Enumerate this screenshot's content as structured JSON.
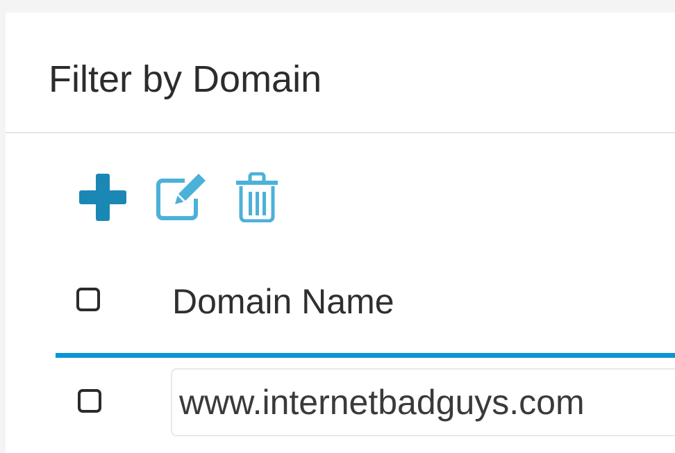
{
  "panel": {
    "title": "Filter by Domain"
  },
  "toolbar": {
    "add_icon": "plus-icon",
    "edit_icon": "edit-icon",
    "delete_icon": "trash-icon",
    "colors": {
      "add": "#1b87b5",
      "edit_delete": "#4cb1d9"
    }
  },
  "table": {
    "header": {
      "select_all_checked": false,
      "column_label": "Domain Name"
    },
    "rows": [
      {
        "checked": false,
        "domain_value": "www.internetbadguys.com"
      }
    ]
  },
  "colors": {
    "accent_line": "#0a95d3"
  }
}
